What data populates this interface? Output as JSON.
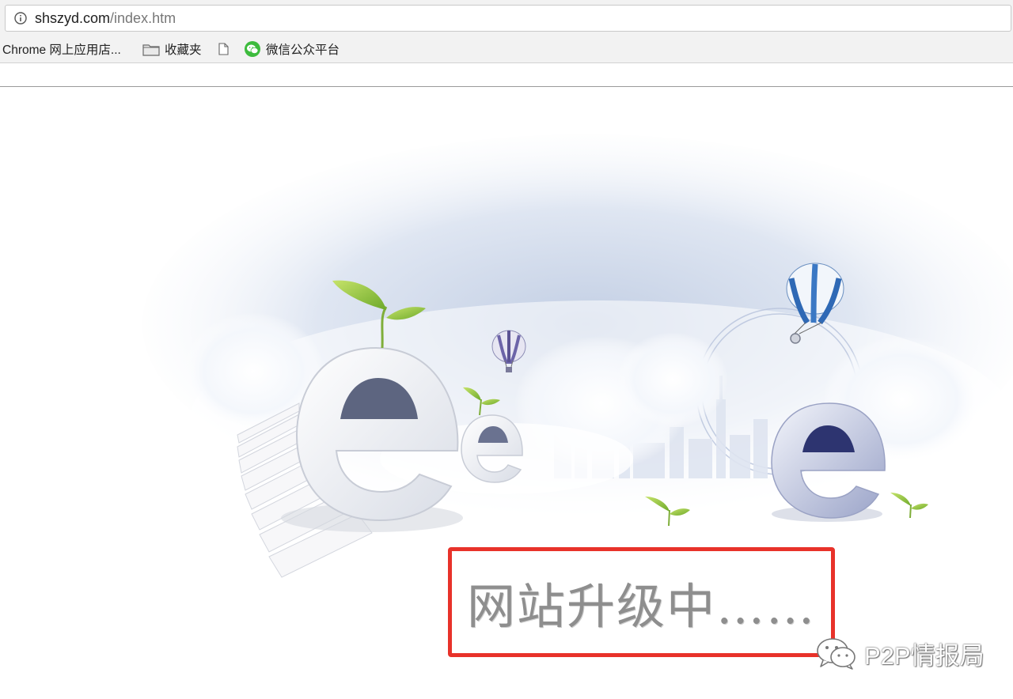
{
  "browser": {
    "url_host": "shszyd.com",
    "url_path": "/index.htm",
    "bookmarks": [
      {
        "label": "Chrome 网上应用店...",
        "icon": "apps-icon"
      },
      {
        "label": "收藏夹",
        "icon": "folder-icon"
      },
      {
        "label": "",
        "icon": "page-icon"
      },
      {
        "label": "微信公众平台",
        "icon": "wechat-icon"
      }
    ]
  },
  "page": {
    "notice": "网站升级中……",
    "highlight_color": "#e8322a"
  },
  "watermark": {
    "text": "P2P情报局",
    "icon": "wechat-icon"
  }
}
